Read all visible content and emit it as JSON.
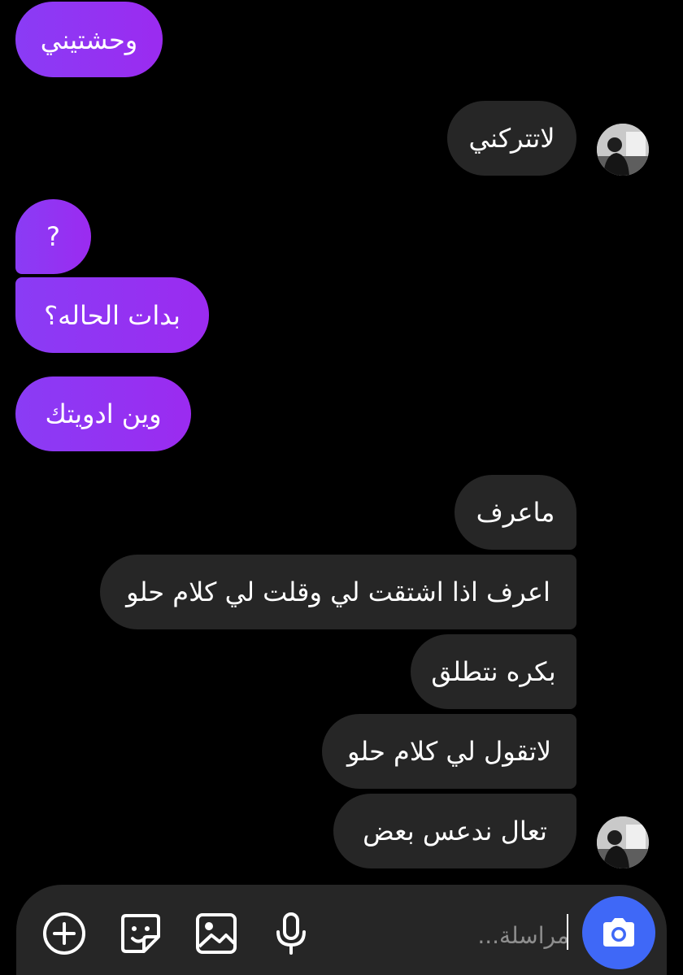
{
  "colors": {
    "background": "#000000",
    "outgoing_bubble": "#8a3cf5",
    "incoming_bubble": "#262626",
    "camera_button": "#3f68f7",
    "composer": "#262626"
  },
  "messages": [
    {
      "direction": "outgoing",
      "text": "وحشتيني"
    },
    {
      "direction": "incoming",
      "text": "لاتتركني"
    },
    {
      "direction": "outgoing",
      "text": "?"
    },
    {
      "direction": "outgoing",
      "text": "بدات الحاله؟"
    },
    {
      "direction": "outgoing",
      "text": "وين ادويتك"
    },
    {
      "direction": "incoming",
      "text": "ماعرف"
    },
    {
      "direction": "incoming",
      "text": "اعرف اذا اشتقت لي وقلت لي كلام حلو"
    },
    {
      "direction": "incoming",
      "text": "بكره نتطلق"
    },
    {
      "direction": "incoming",
      "text": "لاتقول لي كلام حلو"
    },
    {
      "direction": "incoming",
      "text": "تعال ندعس بعض"
    }
  ],
  "composer": {
    "placeholder": "مراسلة...",
    "icons": [
      "add-icon",
      "sticker-icon",
      "gallery-icon",
      "microphone-icon",
      "camera-icon"
    ]
  }
}
